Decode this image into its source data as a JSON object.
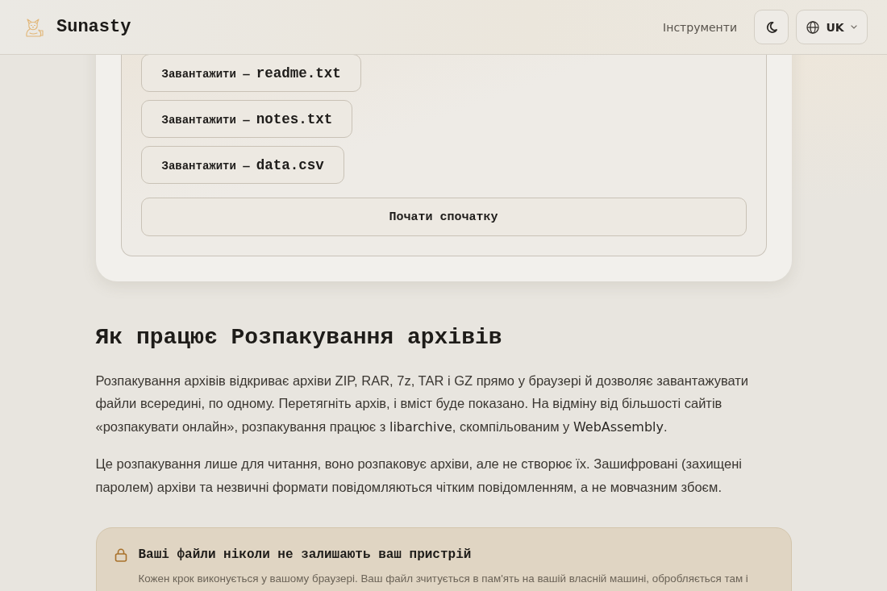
{
  "header": {
    "brand": "Sunasty",
    "nav_link": "Інструменти",
    "language": "UK"
  },
  "downloads": [
    {
      "label": "Завантажити —",
      "file": "readme.txt"
    },
    {
      "label": "Завантажити —",
      "file": "notes.txt"
    },
    {
      "label": "Завантажити —",
      "file": "data.csv"
    }
  ],
  "restart_button": "Почати спочатку",
  "section": {
    "heading": "Як працює Розпакування архівів",
    "paragraphs": [
      [
        {
          "kind": "text",
          "text": "Розпакування архівів відкриває архіви ZIP, RAR, 7z, TAR і GZ прямо у браузері й дозволяє завантажувати файли всередині, по одному. Перетягніть архів, і вміст буде показано. На відміну від більшості сайтів «розпакувати онлайн», розпакування працює з "
        },
        {
          "kind": "term",
          "text": "libarchive"
        },
        {
          "kind": "text",
          "text": ", скомпільованим у "
        },
        {
          "kind": "term",
          "text": "WebAssembly"
        },
        {
          "kind": "text",
          "text": "."
        }
      ],
      [
        {
          "kind": "text",
          "text": "Це розпакування лише для читання, воно розпаковує архіви, але не створює їх. Зашифровані (захищені паролем) архіви та незвичні формати повідомляються чітким повідомленням, а не мовчазним збоєм."
        }
      ]
    ]
  },
  "notice": {
    "title": "Ваші файли ніколи не залишають ваш пристрій",
    "text": "Кожен крок виконується у вашому браузері. Ваш файл зчитується в пам'ять на вашій власній машині, обробляється там і"
  }
}
